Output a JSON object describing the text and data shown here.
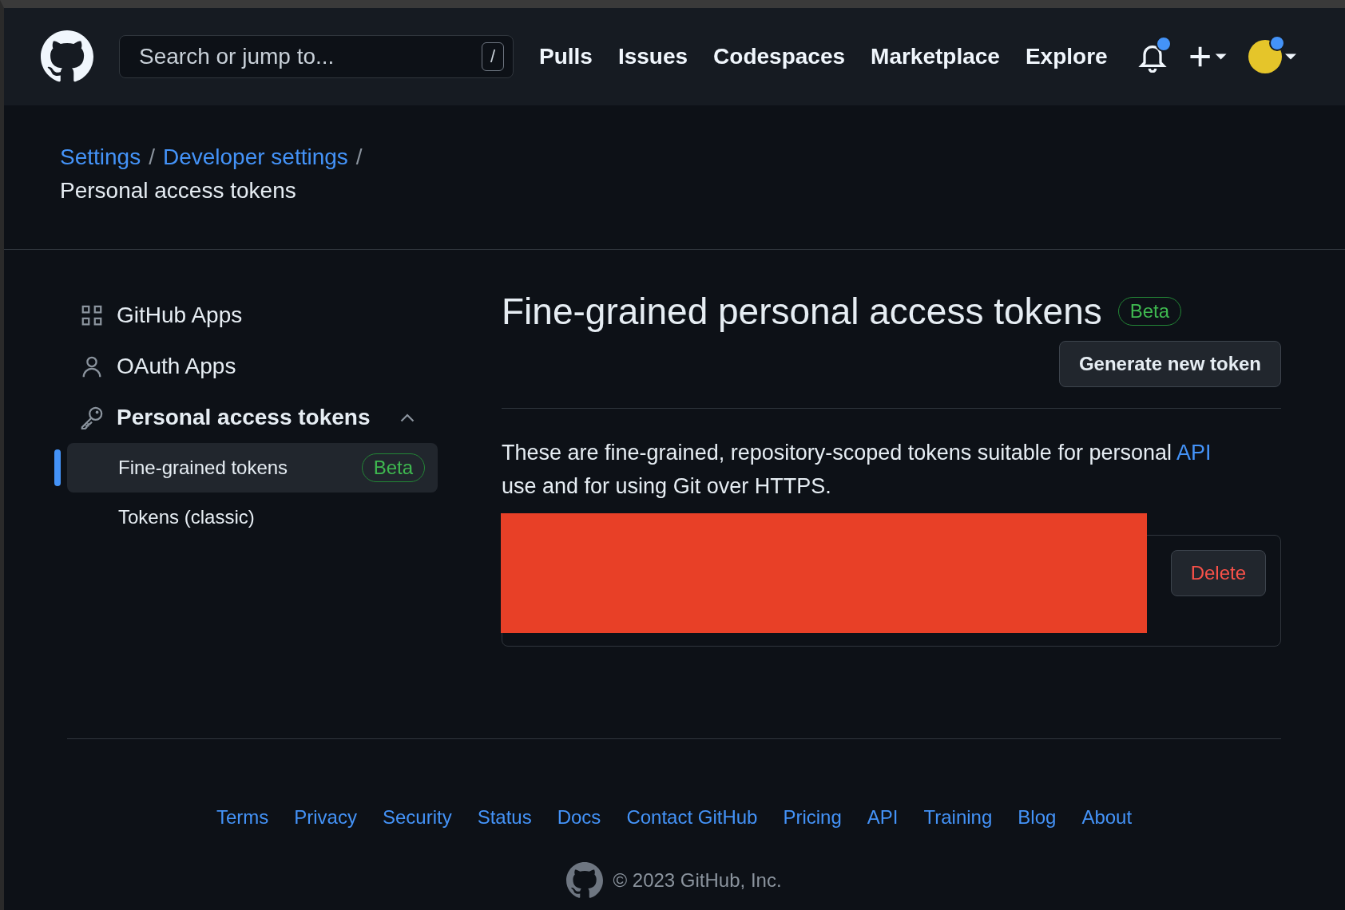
{
  "header": {
    "search": {
      "placeholder": "Search or jump to...",
      "shortcut": "/"
    },
    "nav": [
      "Pulls",
      "Issues",
      "Codespaces",
      "Marketplace",
      "Explore"
    ]
  },
  "breadcrumb": {
    "links": [
      "Settings",
      "Developer settings"
    ],
    "separator": "/",
    "current": "Personal access tokens"
  },
  "sidebar": {
    "items": [
      {
        "label": "GitHub Apps",
        "expanded": false
      },
      {
        "label": "OAuth Apps",
        "expanded": false
      },
      {
        "label": "Personal access tokens",
        "expanded": true,
        "children": [
          {
            "label": "Fine-grained tokens",
            "badge": "Beta",
            "selected": true
          },
          {
            "label": "Tokens (classic)",
            "selected": false
          }
        ]
      }
    ]
  },
  "main": {
    "title": "Fine-grained personal access tokens",
    "badge": "Beta",
    "generate_button": "Generate new token",
    "description_parts": [
      "These are fine-grained, repository-scoped tokens suitable for personal ",
      "API",
      " use and for using Git over HTTPS."
    ],
    "token": {
      "delete_button": "Delete"
    }
  },
  "footer": {
    "links": [
      "Terms",
      "Privacy",
      "Security",
      "Status",
      "Docs",
      "Contact GitHub",
      "Pricing",
      "API",
      "Training",
      "Blog",
      "About"
    ],
    "copyright": "© 2023 GitHub, Inc."
  }
}
